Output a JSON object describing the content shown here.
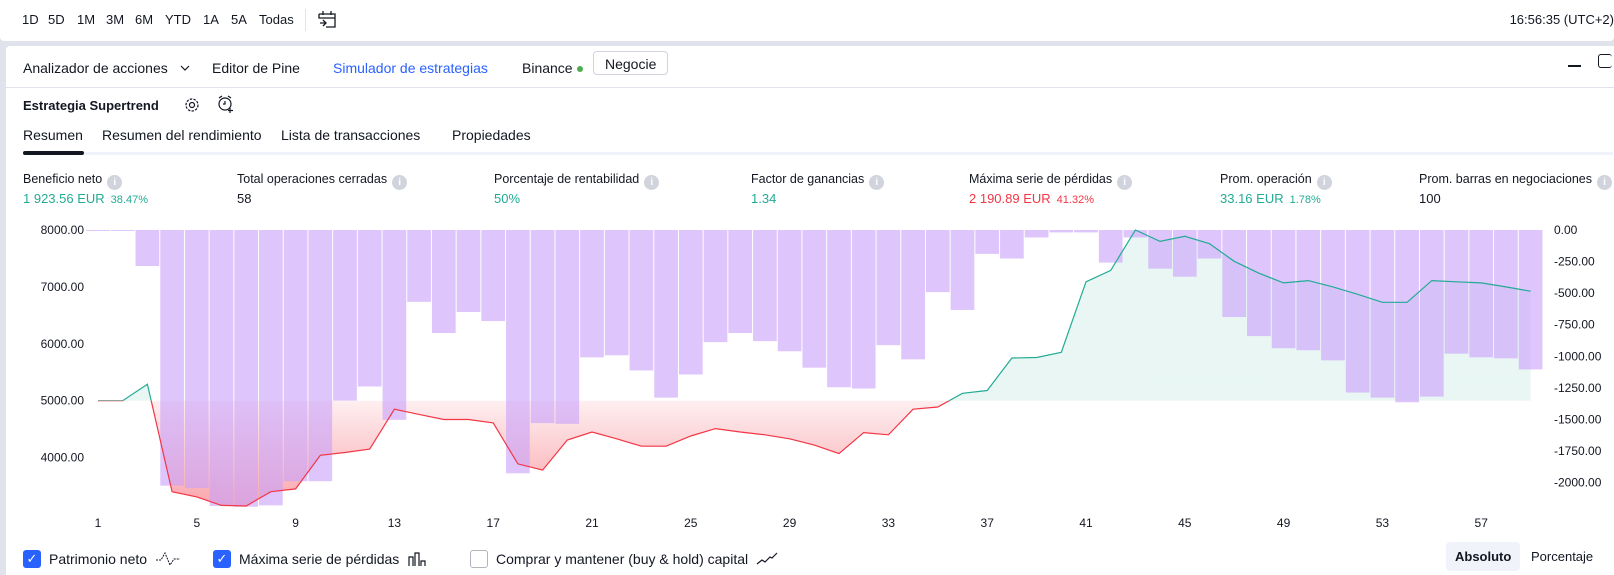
{
  "toolbar": {
    "timeframes": [
      "1D",
      "5D",
      "1M",
      "3M",
      "6M",
      "YTD",
      "1A",
      "5A",
      "Todas"
    ],
    "calendar_icon": "calendar-goto-icon",
    "clock": "16:56:35 (UTC+2)"
  },
  "panel_header": {
    "tabs": [
      "Analizador de acciones",
      "Editor de Pine",
      "Simulador de estrategias"
    ],
    "active_tab": "Simulador de estrategias",
    "broker": "Binance",
    "broker_status_color": "#4caf50",
    "trade_button": "Negocie",
    "accent": "#2962ff"
  },
  "strategy": {
    "title": "Estrategia Supertrend",
    "tabs": [
      "Resumen",
      "Resumen del rendimiento",
      "Lista de transacciones",
      "Propiedades"
    ],
    "active_tab": "Resumen"
  },
  "stats": [
    {
      "label": "Beneficio neto",
      "value": "1 923.56 EUR",
      "sub": "38.47%",
      "tone": "green"
    },
    {
      "label": "Total operaciones cerradas",
      "value": "58",
      "sub": "",
      "tone": "neutral"
    },
    {
      "label": "Porcentaje de rentabilidad",
      "value": "50%",
      "sub": "",
      "tone": "green"
    },
    {
      "label": "Factor de ganancias",
      "value": "1.34",
      "sub": "",
      "tone": "green"
    },
    {
      "label": "Máxima serie de pérdidas",
      "value": "2 190.89 EUR",
      "sub": "41.32%",
      "tone": "red"
    },
    {
      "label": "Prom. operación",
      "value": "33.16 EUR",
      "sub": "1.78%",
      "tone": "green"
    },
    {
      "label": "Prom. barras en negociaciones",
      "value": "100",
      "sub": "",
      "tone": "neutral"
    }
  ],
  "chart_data": {
    "type": "line+bar",
    "x": [
      1,
      2,
      3,
      4,
      5,
      6,
      7,
      8,
      9,
      10,
      11,
      12,
      13,
      14,
      15,
      16,
      17,
      18,
      19,
      20,
      21,
      22,
      23,
      24,
      25,
      26,
      27,
      28,
      29,
      30,
      31,
      32,
      33,
      34,
      35,
      36,
      37,
      38,
      39,
      40,
      41,
      42,
      43,
      44,
      45,
      46,
      47,
      48,
      49,
      50,
      51,
      52,
      53,
      54,
      55,
      56,
      57,
      58,
      59
    ],
    "x_ticks": [
      "1",
      "5",
      "9",
      "13",
      "17",
      "21",
      "25",
      "29",
      "33",
      "37",
      "41",
      "45",
      "49",
      "53",
      "57"
    ],
    "left_axis": {
      "ticks": [
        "8000.00",
        "7000.00",
        "6000.00",
        "5000.00",
        "4000.00"
      ],
      "baseline": 5000
    },
    "right_axis": {
      "ticks": [
        "0.00",
        "-250.00",
        "-500.00",
        "-750.00",
        "-1000.00",
        "-1250.00",
        "-1500.00",
        "-1750.00",
        "-2000.00"
      ]
    },
    "series": [
      {
        "name": "Patrimonio neto",
        "axis": "left",
        "type": "area-line",
        "values": [
          5000,
          5000,
          5290,
          3400,
          3310,
          3160,
          3150,
          3400,
          3450,
          4040,
          4090,
          4150,
          4850,
          4760,
          4670,
          4670,
          4610,
          3890,
          3780,
          4310,
          4450,
          4330,
          4200,
          4200,
          4380,
          4510,
          4450,
          4400,
          4330,
          4220,
          4070,
          4440,
          4400,
          4850,
          4890,
          5130,
          5180,
          5750,
          5760,
          5850,
          7090,
          7290,
          8000,
          7800,
          7890,
          7760,
          7450,
          7240,
          7070,
          7110,
          7000,
          6870,
          6730,
          6730,
          7110,
          7090,
          7070,
          7000,
          6924
        ],
        "colors": {
          "up": "#22ab94",
          "down": "#f23645"
        }
      },
      {
        "name": "Máxima serie de pérdidas",
        "axis": "right",
        "type": "bar",
        "values": [
          -5,
          -5,
          -285,
          -2024,
          -2043,
          -2185,
          -2190.89,
          -2180,
          -1989,
          -1989,
          -1351,
          -1239,
          -1503,
          -569,
          -816,
          -649,
          -721,
          -1926,
          -1529,
          -1535,
          -1008,
          -992,
          -1112,
          -1327,
          -1144,
          -888,
          -816,
          -880,
          -960,
          -1090,
          -1245,
          -1255,
          -912,
          -1024,
          -492,
          -633,
          -189,
          -226,
          -59,
          -19,
          -19,
          -258,
          -59,
          -306,
          -370,
          -226,
          -689,
          -840,
          -936,
          -952,
          -1032,
          -1287,
          -1327,
          -1364,
          -1319,
          -979,
          -1008,
          -1016,
          -1104
        ],
        "color": "#d8b5fb"
      }
    ]
  },
  "legend": [
    {
      "label": "Patrimonio neto",
      "checked": true,
      "icon": "equity-line-icon"
    },
    {
      "label": "Máxima serie de pérdidas",
      "checked": true,
      "icon": "bars-icon"
    },
    {
      "label": "Comprar y mantener (buy & hold) capital",
      "checked": false,
      "icon": "trend-line-icon"
    }
  ],
  "view_mode": {
    "options": [
      "Absoluto",
      "Porcentaje"
    ],
    "selected": "Absoluto"
  }
}
